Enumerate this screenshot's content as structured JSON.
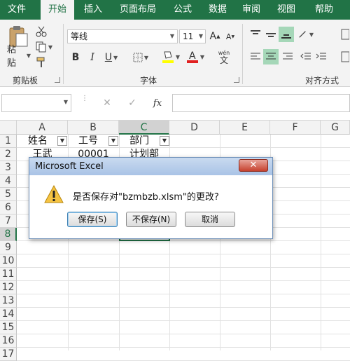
{
  "ribbon_tabs": [
    "文件",
    "开始",
    "插入",
    "页面布局",
    "公式",
    "数据",
    "审阅",
    "视图",
    "帮助"
  ],
  "active_tab": "开始",
  "clipboard": {
    "paste_label": "粘贴",
    "group_label": "剪贴板"
  },
  "font": {
    "name": "等线",
    "size": "11",
    "bold": "B",
    "italic": "I",
    "underline": "U",
    "wen": "wén",
    "wen_char": "文",
    "group_label": "字体"
  },
  "alignment": {
    "group_label": "对齐方式"
  },
  "formula_bar": {
    "cancel": "✕",
    "enter": "✓",
    "fx": "fx",
    "value": ""
  },
  "columns": [
    "A",
    "B",
    "C",
    "D",
    "E",
    "F",
    "G"
  ],
  "rows": [
    "1",
    "2",
    "3",
    "4",
    "5",
    "6",
    "7",
    "8",
    "9",
    "10",
    "11",
    "12",
    "13",
    "14",
    "15",
    "16",
    "17"
  ],
  "selected_row": "8",
  "selected_column": "C",
  "cells": {
    "a1": "姓名",
    "b1": "工号",
    "c1": "部门",
    "a2": "王武",
    "b2": "00001",
    "c2": "计划部"
  },
  "dialog": {
    "title": "Microsoft Excel",
    "close": "✕",
    "message": "是否保存对\"bzmbzb.xlsm\"的更改?",
    "buttons": {
      "save": "保存(S)",
      "dont_save": "不保存(N)",
      "cancel": "取消"
    }
  },
  "colors": {
    "accent": "#217346",
    "dialog_title": "#a9c3e6",
    "close_button": "#c7412e"
  },
  "icons": [
    "paste-icon",
    "cut-icon",
    "copy-icon",
    "format-painter-icon",
    "warning-icon",
    "filter-icon"
  ]
}
